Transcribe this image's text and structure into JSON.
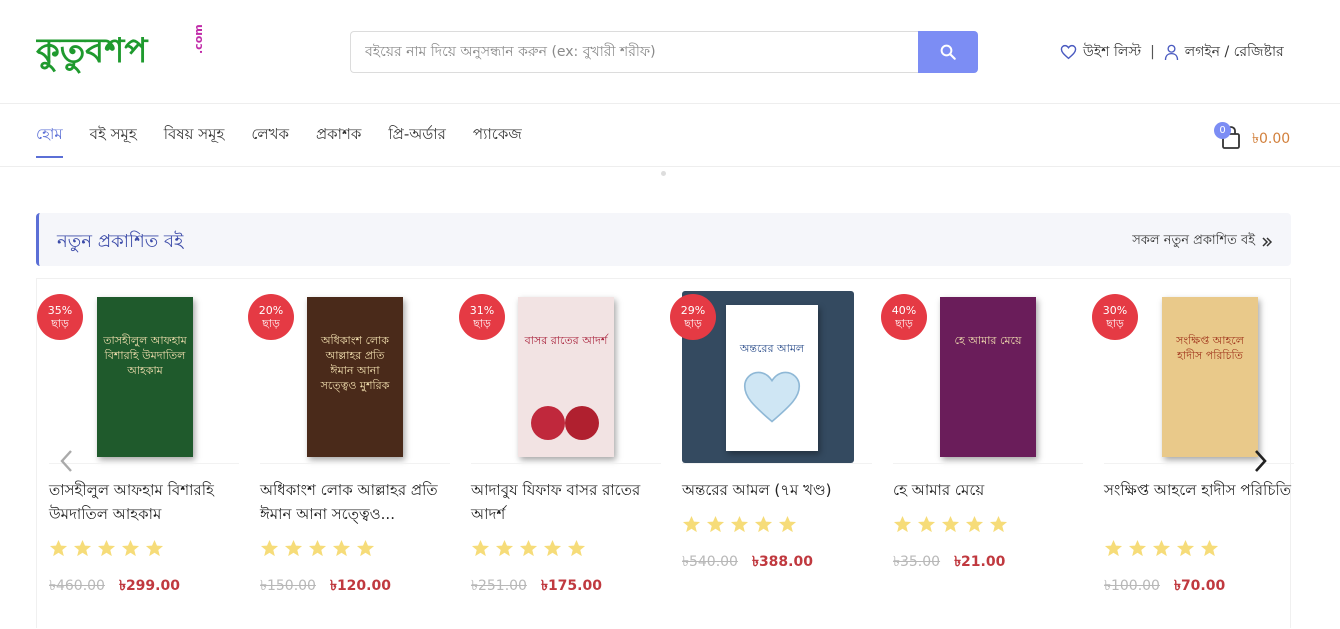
{
  "header": {
    "logo_text": "কুতুবশপ",
    "logo_suffix": ".com",
    "search": {
      "placeholder": "বইয়ের নাম দিয়ে অনুসন্ধান করুন (ex: বুখারী শরীফ)"
    },
    "wishlist_label": "উইশ লিস্ট",
    "separator": "|",
    "login_label": "লগইন / রেজিষ্টার"
  },
  "nav": {
    "items": [
      {
        "label": "হোম",
        "active": true
      },
      {
        "label": "বই সমূহ"
      },
      {
        "label": "বিষয় সমূহ"
      },
      {
        "label": "লেখক"
      },
      {
        "label": "প্রকাশক"
      },
      {
        "label": "প্রি-অর্ডার"
      },
      {
        "label": "প্যাকেজ"
      }
    ]
  },
  "cart": {
    "count": "0",
    "total": "৳0.00"
  },
  "section": {
    "title": "নতুন প্রকাশিত বই",
    "link": "সকল নতুন প্রকাশিত বই"
  },
  "products": [
    {
      "discount": "35%",
      "discount_word": "ছাড়",
      "title": "তাসহীলুল আফহাম বিশারহি উমদাতিল আহকাম",
      "old_price": "৳460.00",
      "new_price": "৳299.00",
      "cover_text": "তাসহীলুল আফহাম বিশারহি উমদাতিল আহকাম",
      "cover_color": "#1f5a2c"
    },
    {
      "discount": "20%",
      "discount_word": "ছাড়",
      "title": "অধিকাংশ লোক আল্লাহর প্রতি ঈমান আনা সত্ত্বেও...",
      "old_price": "৳150.00",
      "new_price": "৳120.00",
      "cover_text": "অধিকাংশ লোক আল্লাহর প্রতি ঈমান আনা সত্ত্বেও মুশরিক",
      "cover_color": "#4a2a1a"
    },
    {
      "discount": "31%",
      "discount_word": "ছাড়",
      "title": "আদাবুয যিফাফ বাসর রাতের আদর্শ",
      "old_price": "৳251.00",
      "new_price": "৳175.00",
      "cover_text": "বাসর রাতের আদর্শ",
      "cover_color": "#f2e3e3"
    },
    {
      "discount": "29%",
      "discount_word": "ছাড়",
      "title": "অন্তরের আমল (৭ম খণ্ড)",
      "old_price": "৳540.00",
      "new_price": "৳388.00",
      "cover_text": "অন্তরের আমল",
      "cover_color": "#ffffff"
    },
    {
      "discount": "40%",
      "discount_word": "ছাড়",
      "title": "হে আমার মেয়ে",
      "old_price": "৳35.00",
      "new_price": "৳21.00",
      "cover_text": "হে আমার মেয়ে",
      "cover_color": "#6a1d5a"
    },
    {
      "discount": "30%",
      "discount_word": "ছাড়",
      "title": "সংক্ষিপ্ত আহলে হাদীস পরিচিতি",
      "old_price": "৳100.00",
      "new_price": "৳70.00",
      "cover_text": "সংক্ষিপ্ত আহলে হাদীস পরিচিতি",
      "cover_color": "#e9c98a"
    }
  ],
  "colors": {
    "accent": "#5b6fd6",
    "discount": "#e53a44",
    "star": "#f6dc79",
    "price": "#c0393f",
    "cart_total": "#d2803c",
    "logo_green": "#1f9a2e"
  }
}
